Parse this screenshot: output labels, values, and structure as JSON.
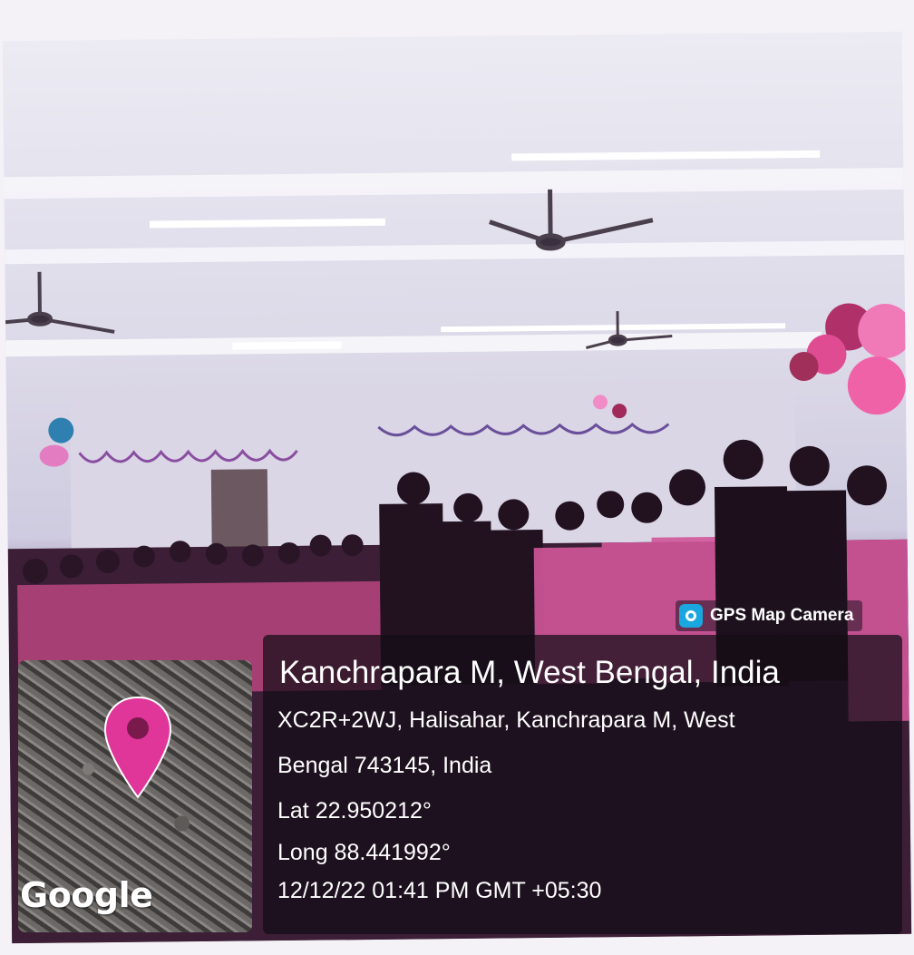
{
  "gps_badge": {
    "label": "GPS Map Camera",
    "icon": "camera-icon"
  },
  "location": {
    "title": "Kanchrapara M, West Bengal, India",
    "address_line1": "XC2R+2WJ, Halisahar, Kanchrapara M, West",
    "address_line2": "Bengal 743145, India",
    "lat": "Lat 22.950212°",
    "long": "Long 88.441992°",
    "datetime": "12/12/22 01:41 PM GMT +05:30"
  },
  "map": {
    "logo": "Google",
    "pin_icon": "map-pin-icon",
    "pin_color": "#e0369a"
  }
}
